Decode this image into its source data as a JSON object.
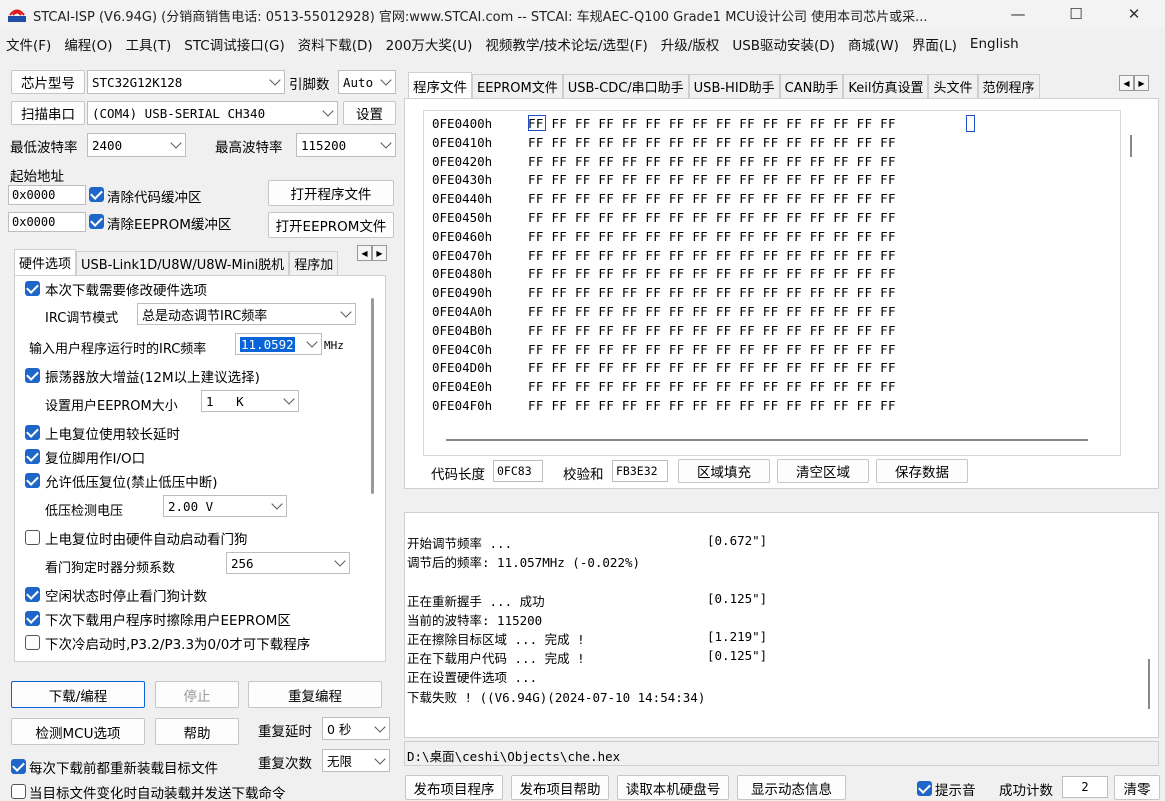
{
  "window": {
    "title": "STCAI-ISP (V6.94G) (分销商销售电话: 0513-55012928) 官网:www.STCAI.com  -- STCAI: 车规AEC-Q100 Grade1 MCU设计公司 使用本司芯片或采...",
    "minimize": "—",
    "maximize": "☐",
    "close": "✕"
  },
  "menu": [
    "文件(F)",
    "编程(O)",
    "工具(T)",
    "STC调试接口(G)",
    "资料下载(D)",
    "200万大奖(U)",
    "视频教学/技术论坛/选型(F)",
    "升级/版权",
    "USB驱动安装(D)",
    "商城(W)",
    "界面(L)",
    "English"
  ],
  "left": {
    "chip_label": "芯片型号",
    "chip_value": "STC32G12K128",
    "pin_label": "引脚数",
    "pin_value": "Auto",
    "scan_label": "扫描串口",
    "port_value": "(COM4) USB-SERIAL CH340",
    "settings_label": "设置",
    "min_baud_label": "最低波特率",
    "min_baud_value": "2400",
    "max_baud_label": "最高波特率",
    "max_baud_value": "115200",
    "start_addr_label": "起始地址",
    "code_addr": "0x0000",
    "clear_code_label": "清除代码缓冲区",
    "open_prog_label": "打开程序文件",
    "eeprom_addr": "0x0000",
    "clear_eeprom_label": "清除EEPROM缓冲区",
    "open_eeprom_label": "打开EEPROM文件"
  },
  "left_tabs": [
    "硬件选项",
    "USB-Link1D/U8W/U8W-Mini脱机",
    "程序加"
  ],
  "hw": {
    "modify_hw": "本次下载需要修改硬件选项",
    "irc_mode_label": "IRC调节模式",
    "irc_mode_value": "总是动态调节IRC频率",
    "irc_freq_label": "输入用户程序运行时的IRC频率",
    "irc_freq_value": "11.0592",
    "irc_freq_unit": "MHz",
    "osc_gain": "振荡器放大增益(12M以上建议选择)",
    "eeprom_size_label": "设置用户EEPROM大小",
    "eeprom_size_value": "1   K",
    "long_delay": "上电复位使用较长延时",
    "reset_io": "复位脚用作I/O口",
    "lvr": "允许低压复位(禁止低压中断)",
    "lvd_label": "低压检测电压",
    "lvd_value": "2.00 V",
    "wdt_auto": "上电复位时由硬件自动启动看门狗",
    "wdt_div_label": "看门狗定时器分频系数",
    "wdt_div_value": "256",
    "idle_wdt": "空闲状态时停止看门狗计数",
    "erase_eeprom": "下次下载用户程序时擦除用户EEPROM区",
    "cold_boot": "下次冷启动时,P3.2/P3.3为0/0才可下载程序"
  },
  "buttons": {
    "download": "下载/编程",
    "stop": "停止",
    "reprogram": "重复编程",
    "detect": "检测MCU选项",
    "help": "帮助",
    "repeat_delay_label": "重复延时",
    "repeat_delay_value": "0 秒",
    "repeat_count_label": "重复次数",
    "repeat_count_value": "无限",
    "reload_label": "每次下载前都重新装载目标文件",
    "auto_send_label": "当目标文件变化时自动装载并发送下载命令"
  },
  "right_tabs": [
    "程序文件",
    "EEPROM文件",
    "USB-CDC/串口助手",
    "USB-HID助手",
    "CAN助手",
    "Keil仿真设置",
    "头文件",
    "范例程序"
  ],
  "hex_rows": [
    {
      "addr": "0FE0400h",
      "bytes": "FF FF FF FF FF FF FF FF FF FF FF FF FF FF FF FF"
    },
    {
      "addr": "0FE0410h",
      "bytes": "FF FF FF FF FF FF FF FF FF FF FF FF FF FF FF FF"
    },
    {
      "addr": "0FE0420h",
      "bytes": "FF FF FF FF FF FF FF FF FF FF FF FF FF FF FF FF"
    },
    {
      "addr": "0FE0430h",
      "bytes": "FF FF FF FF FF FF FF FF FF FF FF FF FF FF FF FF"
    },
    {
      "addr": "0FE0440h",
      "bytes": "FF FF FF FF FF FF FF FF FF FF FF FF FF FF FF FF"
    },
    {
      "addr": "0FE0450h",
      "bytes": "FF FF FF FF FF FF FF FF FF FF FF FF FF FF FF FF"
    },
    {
      "addr": "0FE0460h",
      "bytes": "FF FF FF FF FF FF FF FF FF FF FF FF FF FF FF FF"
    },
    {
      "addr": "0FE0470h",
      "bytes": "FF FF FF FF FF FF FF FF FF FF FF FF FF FF FF FF"
    },
    {
      "addr": "0FE0480h",
      "bytes": "FF FF FF FF FF FF FF FF FF FF FF FF FF FF FF FF"
    },
    {
      "addr": "0FE0490h",
      "bytes": "FF FF FF FF FF FF FF FF FF FF FF FF FF FF FF FF"
    },
    {
      "addr": "0FE04A0h",
      "bytes": "FF FF FF FF FF FF FF FF FF FF FF FF FF FF FF FF"
    },
    {
      "addr": "0FE04B0h",
      "bytes": "FF FF FF FF FF FF FF FF FF FF FF FF FF FF FF FF"
    },
    {
      "addr": "0FE04C0h",
      "bytes": "FF FF FF FF FF FF FF FF FF FF FF FF FF FF FF FF"
    },
    {
      "addr": "0FE04D0h",
      "bytes": "FF FF FF FF FF FF FF FF FF FF FF FF FF FF FF FF"
    },
    {
      "addr": "0FE04E0h",
      "bytes": "FF FF FF FF FF FF FF FF FF FF FF FF FF FF FF FF"
    },
    {
      "addr": "0FE04F0h",
      "bytes": "FF FF FF FF FF FF FF FF FF FF FF FF FF FF FF FF"
    }
  ],
  "code_info": {
    "length_label": "代码长度",
    "length_value": "0FC83",
    "checksum_label": "校验和",
    "checksum_value": "FB3E32",
    "fill_label": "区域填充",
    "clear_label": "清空区域",
    "save_label": "保存数据"
  },
  "log": [
    {
      "text": "开始调节频率 ...",
      "time": "[0.672\"]"
    },
    {
      "text": "调节后的频率: 11.057MHz (-0.022%)",
      "time": ""
    },
    {
      "text": "",
      "time": ""
    },
    {
      "text": "正在重新握手 ... 成功",
      "time": "[0.125\"]"
    },
    {
      "text": "当前的波特率: 115200",
      "time": ""
    },
    {
      "text": "正在擦除目标区域 ... 完成 !",
      "time": "[1.219\"]"
    },
    {
      "text": "正在下载用户代码 ... 完成 !",
      "time": "[0.125\"]"
    },
    {
      "text": "正在设置硬件选项 ...",
      "time": ""
    },
    {
      "text": "下载失败 ! ((V6.94G)(2024-07-10 14:54:34)",
      "time": ""
    }
  ],
  "file_path": "D:\\桌面\\ceshi\\Objects\\che.hex",
  "bottom": {
    "publish_prog": "发布项目程序",
    "publish_help": "发布项目帮助",
    "read_disk": "读取本机硬盘号",
    "show_dynamic": "显示动态信息",
    "beep_label": "提示音",
    "success_label": "成功计数",
    "success_value": "2",
    "clear_label": "清零"
  }
}
